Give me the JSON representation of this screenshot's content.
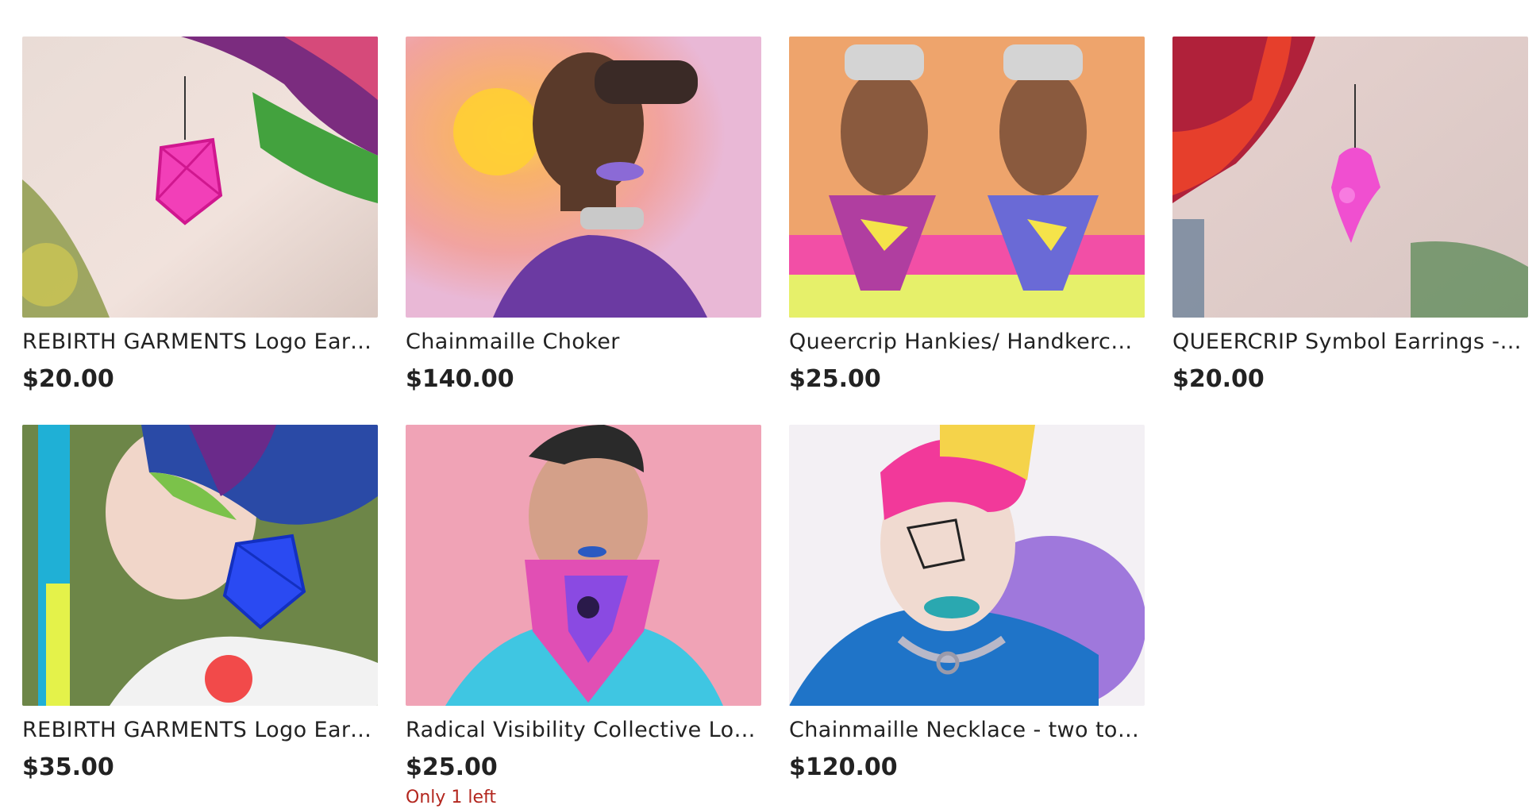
{
  "listings": [
    {
      "title": "REBIRTH GARMENTS Logo Earri...",
      "price": "$20.00",
      "image": "earring-pink-photo"
    },
    {
      "title": "Chainmaille Choker",
      "price": "$140.00",
      "image": "choker-photo"
    },
    {
      "title": "Queercrip Hankies/ Handkerchi...",
      "price": "$25.00",
      "image": "hankies-photo"
    },
    {
      "title": "QUEERCRIP Symbol Earrings - ...",
      "price": "$20.00",
      "image": "earring-symbol-photo"
    },
    {
      "title": "REBIRTH GARMENTS Logo Earri...",
      "price": "$35.00",
      "image": "earring-blue-photo"
    },
    {
      "title": "Radical Visibility Collective Log...",
      "price": "$25.00",
      "stock": "Only 1 left",
      "image": "bandana-photo"
    },
    {
      "title": "Chainmaille Necklace - two ton...",
      "price": "$120.00",
      "image": "necklace-photo"
    }
  ],
  "colors": {
    "text": "#222222",
    "stock_warning": "#b3261e"
  }
}
